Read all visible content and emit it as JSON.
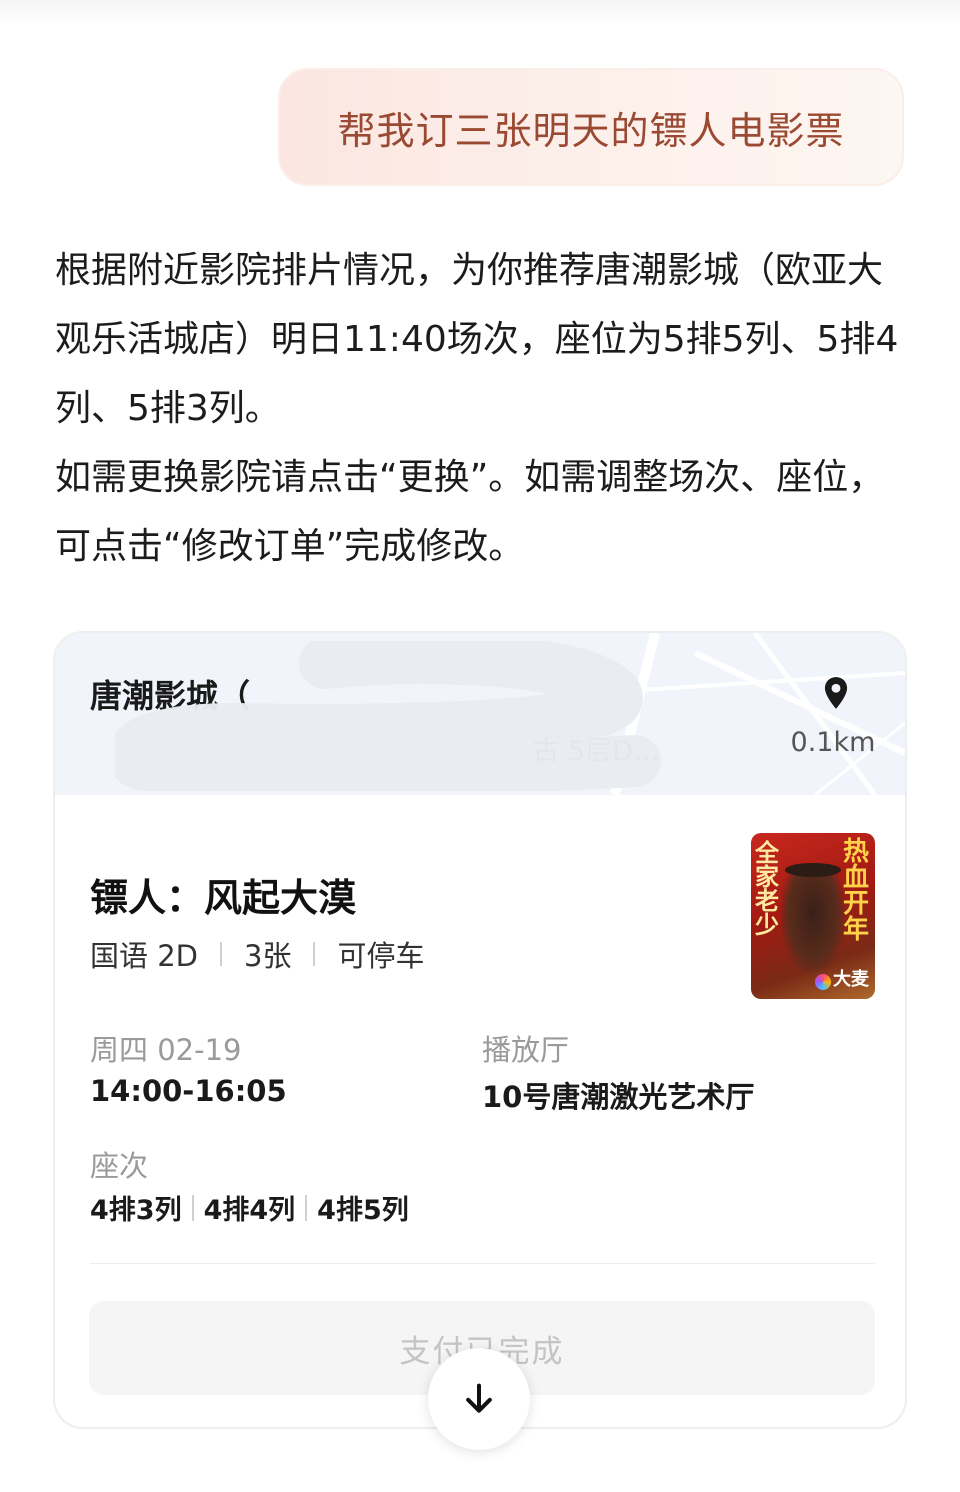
{
  "user_message": "帮我订三张明天的镖人电影票",
  "reply": {
    "paragraph_1": "根据附近影院排片情况，为你推荐唐潮影城（欧亚大观乐活城店）明日11:40场次，座位为5排5列、5排4列、5排3列。",
    "paragraph_2": "如需更换影院请点击“更换”。如需调整场次、座位，可点击“修改订单”完成修改。"
  },
  "card": {
    "cinema_name": "唐潮影城（",
    "cinema_address": "古 5层D…",
    "distance": "0.1km",
    "movie_title": "镖人：风起大漠",
    "tags": [
      "国语 2D",
      "3张",
      "可停车"
    ],
    "poster": {
      "left_text": "全家老少",
      "right_text": "热血开年",
      "logo_text": "大麦"
    },
    "date_label": "周四 02-19",
    "time_value": "14:00-16:05",
    "hall_label": "播放厅",
    "hall_value": "10号唐潮激光艺术厅",
    "seat_label": "座次",
    "seats": [
      "4排3列",
      "4排4列",
      "4排5列"
    ],
    "pay_button": "支付已完成"
  },
  "colors": {
    "bubble_text": "#9a4a33",
    "bubble_bg": "#fbe6e1",
    "header_bg": "#f1f5fb",
    "muted": "#9a9a9a"
  },
  "icons": {
    "location": "location-pin-icon",
    "scroll": "arrow-down-icon"
  }
}
